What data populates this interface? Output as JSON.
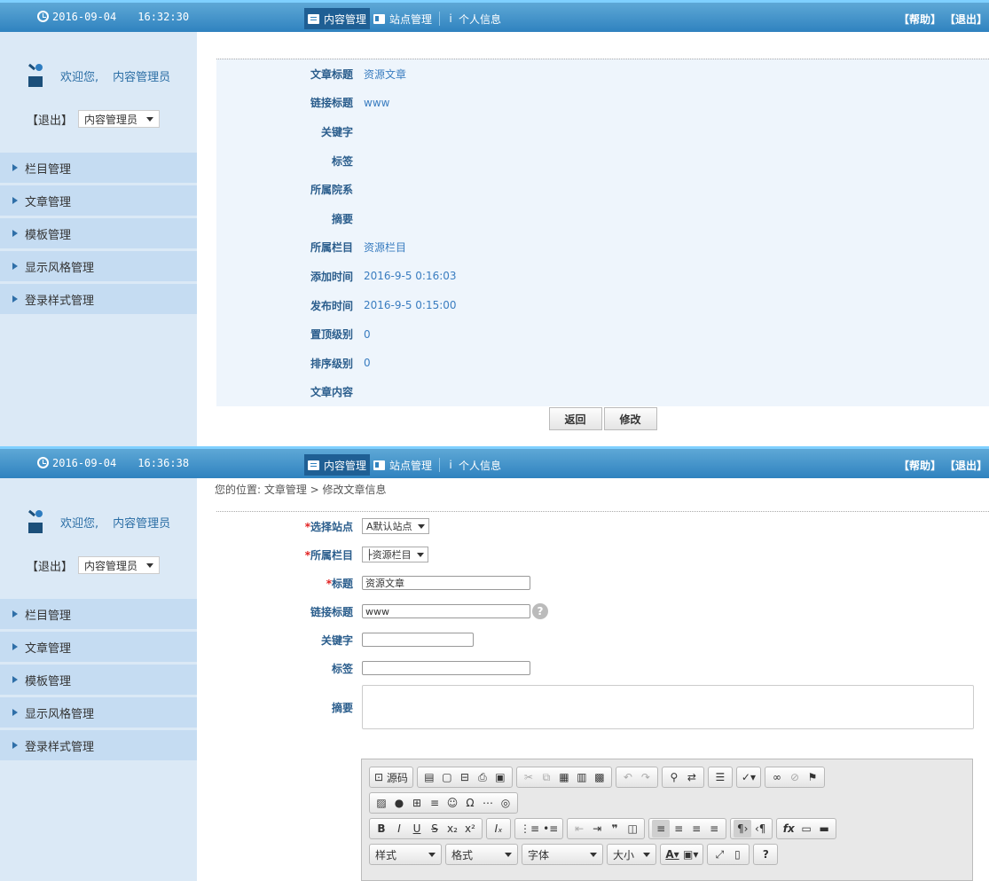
{
  "panel1": {
    "topbar": {
      "date": "2016-09-04",
      "time": "16:32:30",
      "nav": [
        "内容管理",
        "站点管理",
        "个人信息"
      ],
      "help": "【帮助】",
      "logout": "【退出】"
    },
    "sidebar": {
      "welcome": "欢迎您,",
      "user": "内容管理员",
      "logout": "【退出】",
      "role": "内容管理员",
      "menu": [
        "栏目管理",
        "文章管理",
        "模板管理",
        "显示风格管理",
        "登录样式管理"
      ]
    },
    "detail": {
      "rows": [
        {
          "label": "文章标题",
          "value": "资源文章"
        },
        {
          "label": "链接标题",
          "value": "www"
        },
        {
          "label": "关键字",
          "value": ""
        },
        {
          "label": "标签",
          "value": ""
        },
        {
          "label": "所属院系",
          "value": ""
        },
        {
          "label": "摘要",
          "value": ""
        },
        {
          "label": "所属栏目",
          "value": "资源栏目"
        },
        {
          "label": "添加时间",
          "value": "2016-9-5 0:16:03"
        },
        {
          "label": "发布时间",
          "value": "2016-9-5 0:15:00"
        },
        {
          "label": "置顶级别",
          "value": "0"
        },
        {
          "label": "排序级别",
          "value": "0"
        },
        {
          "label": "文章内容",
          "value": ""
        }
      ],
      "back_button": "返回",
      "edit_button": "修改"
    }
  },
  "panel2": {
    "topbar": {
      "date": "2016-09-04",
      "time": "16:36:38",
      "nav": [
        "内容管理",
        "站点管理",
        "个人信息"
      ],
      "help": "【帮助】",
      "logout": "【退出】"
    },
    "sidebar": {
      "welcome": "欢迎您,",
      "user": "内容管理员",
      "logout": "【退出】",
      "role": "内容管理员",
      "menu": [
        "栏目管理",
        "文章管理",
        "模板管理",
        "显示风格管理",
        "登录样式管理"
      ]
    },
    "breadcrumb": "您的位置: 文章管理 > 修改文章信息",
    "form": {
      "site_label": "*选择站点",
      "site_value": "A默认站点",
      "column_label": "*所属栏目",
      "column_value": "├资源栏目",
      "title_label": "*标题",
      "title_value": "资源文章",
      "link_label": "链接标题",
      "link_value": "www",
      "keywords_label": "关键字",
      "keywords_value": "",
      "tags_label": "标签",
      "tags_value": "",
      "summary_label": "摘要",
      "summary_value": ""
    },
    "editor": {
      "source_label": "源码",
      "style_label": "样式",
      "format_label": "格式",
      "font_label": "字体",
      "size_label": "大小"
    }
  }
}
